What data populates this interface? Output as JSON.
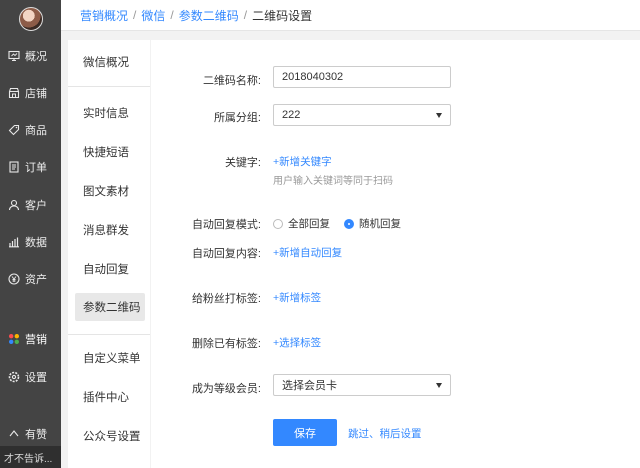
{
  "breadcrumb": {
    "items": [
      "营销概况",
      "微信",
      "参数二维码"
    ],
    "separator": "/",
    "current": "二维码设置"
  },
  "sidebar": {
    "items": [
      {
        "label": "概况",
        "icon": "monitor-icon"
      },
      {
        "label": "店铺",
        "icon": "store-icon"
      },
      {
        "label": "商品",
        "icon": "tag-icon"
      },
      {
        "label": "订单",
        "icon": "list-icon"
      },
      {
        "label": "客户",
        "icon": "user-icon"
      },
      {
        "label": "数据",
        "icon": "bar-chart-icon"
      },
      {
        "label": "资产",
        "icon": "yen-icon"
      },
      {
        "label": "营销",
        "icon": "apps-icon"
      },
      {
        "label": "设置",
        "icon": "gear-icon"
      },
      {
        "label": "有赞",
        "icon": "brand-icon"
      }
    ],
    "footer": "才不告诉..."
  },
  "subnav": {
    "items": [
      "微信概况",
      "实时信息",
      "快捷短语",
      "图文素材",
      "消息群发",
      "自动回复",
      "参数二维码",
      "自定义菜单",
      "插件中心",
      "公众号设置"
    ],
    "active": "参数二维码"
  },
  "form": {
    "name": {
      "label": "二维码名称:",
      "value": "2018040302"
    },
    "group": {
      "label": "所属分组:",
      "value": "222"
    },
    "keyword": {
      "label": "关键字:",
      "link": "+新增关键字",
      "hint": "用户输入关键词等同于扫码"
    },
    "reply_mode": {
      "label": "自动回复模式:",
      "options": [
        "全部回复",
        "随机回复"
      ],
      "selected": "随机回复"
    },
    "reply_content": {
      "label": "自动回复内容:",
      "link": "+新增自动回复"
    },
    "add_tag": {
      "label": "给粉丝打标签:",
      "link": "+新增标签"
    },
    "remove_tag": {
      "label": "删除已有标签:",
      "link": "+选择标签"
    },
    "member_level": {
      "label": "成为等级会员:",
      "value": "选择会员卡"
    },
    "save_label": "保存",
    "skip_label": "跳过、稍后设置"
  },
  "colors": {
    "accent": "#3388ff",
    "sidebar": "#444444"
  }
}
